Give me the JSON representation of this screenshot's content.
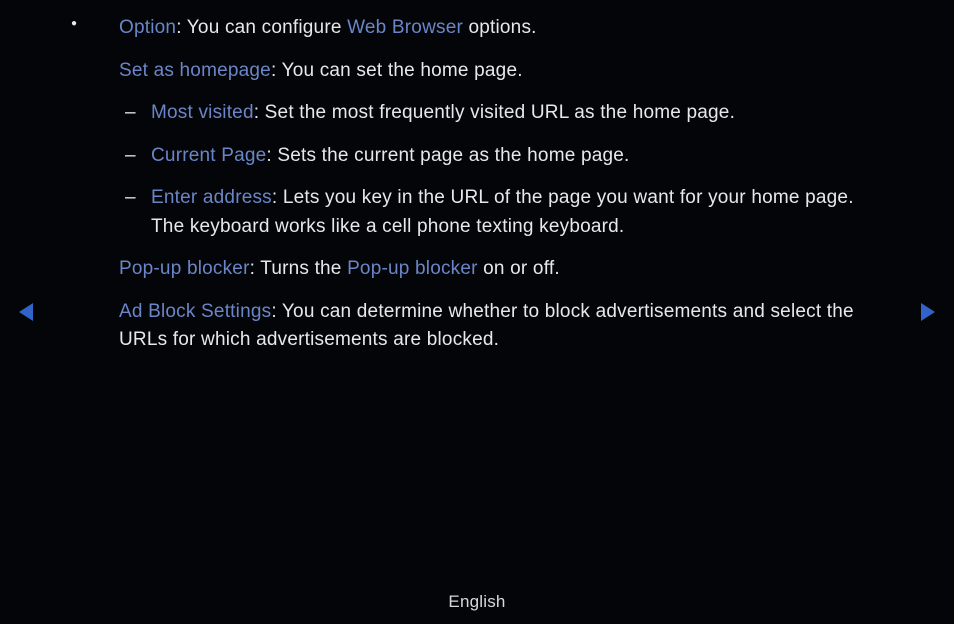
{
  "option": {
    "keyword": "Option",
    "text1": ": You can configure ",
    "keyword2": "Web Browser",
    "text2": " options."
  },
  "homepage": {
    "keyword": "Set as homepage",
    "text": ": You can set the home page."
  },
  "subitems": [
    {
      "keyword": "Most visited",
      "text": ": Set the most frequently visited URL as the home page."
    },
    {
      "keyword": "Current Page",
      "text": ": Sets the current page as the home page."
    },
    {
      "keyword": "Enter address",
      "text": ": Lets you key in the URL of the page you want for your home page. The keyboard works like a cell phone texting keyboard."
    }
  ],
  "popup": {
    "keyword": "Pop-up blocker",
    "text1": ": Turns the ",
    "keyword2": "Pop-up blocker",
    "text2": " on or off."
  },
  "adblock": {
    "keyword": "Ad Block Settings",
    "text": ": You can determine whether to block advertisements and select the URLs for which advertisements are blocked."
  },
  "footer": {
    "language": "English"
  },
  "colors": {
    "background": "#040508",
    "text": "#e8e8ea",
    "keyword": "#6a86c8",
    "arrow": "#3163c8"
  }
}
